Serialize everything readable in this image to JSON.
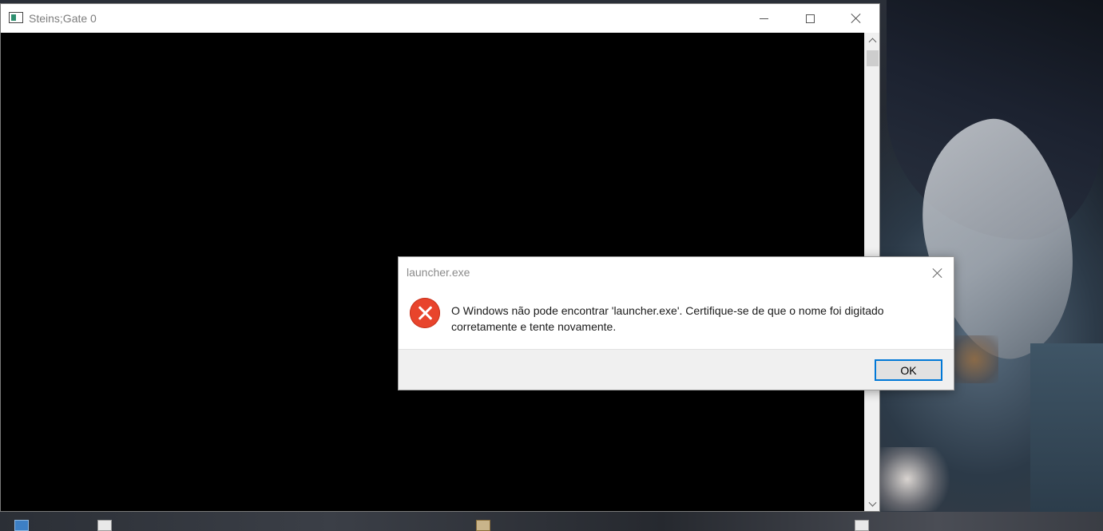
{
  "app_window": {
    "title": "Steins;Gate 0",
    "icon": "app-window-icon",
    "controls": {
      "minimize_icon": "minimize-icon",
      "maximize_icon": "maximize-icon",
      "close_icon": "close-icon"
    }
  },
  "dialog": {
    "title": "launcher.exe",
    "icon": "error-icon",
    "message": "O Windows não pode encontrar 'launcher.exe'. Certifique-se de que o nome foi digitado corretamente e tente novamente.",
    "ok_label": "OK"
  },
  "colors": {
    "error_red": "#e8442c",
    "focus_blue": "#0078d7",
    "dialog_footer": "#f0f0f0",
    "app_content": "#000000"
  }
}
